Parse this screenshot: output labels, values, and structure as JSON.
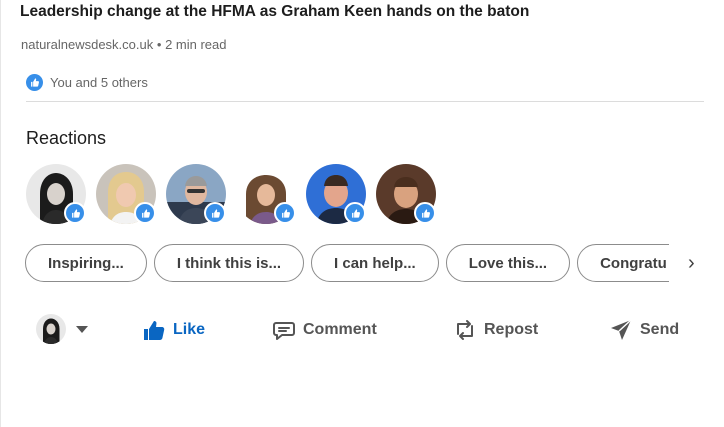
{
  "post": {
    "headline": "Leadership change at the HFMA as Graham Keen hands on the baton",
    "source": "naturalnewsdesk.co.uk",
    "separator": "•",
    "read_time": "2 min read",
    "reaction_summary": "You and 5 others"
  },
  "reactions": {
    "title": "Reactions",
    "people_count": 6,
    "reaction_icon": "thumbs-up-icon",
    "accent": "#378fe9"
  },
  "reply_chips": [
    "Inspiring...",
    "I think this is...",
    "I can help...",
    "Love this...",
    "Congratu"
  ],
  "actions": {
    "like": "Like",
    "comment": "Comment",
    "repost": "Repost",
    "send": "Send",
    "like_color": "#0a66c2"
  },
  "icons": {
    "next": "›"
  }
}
